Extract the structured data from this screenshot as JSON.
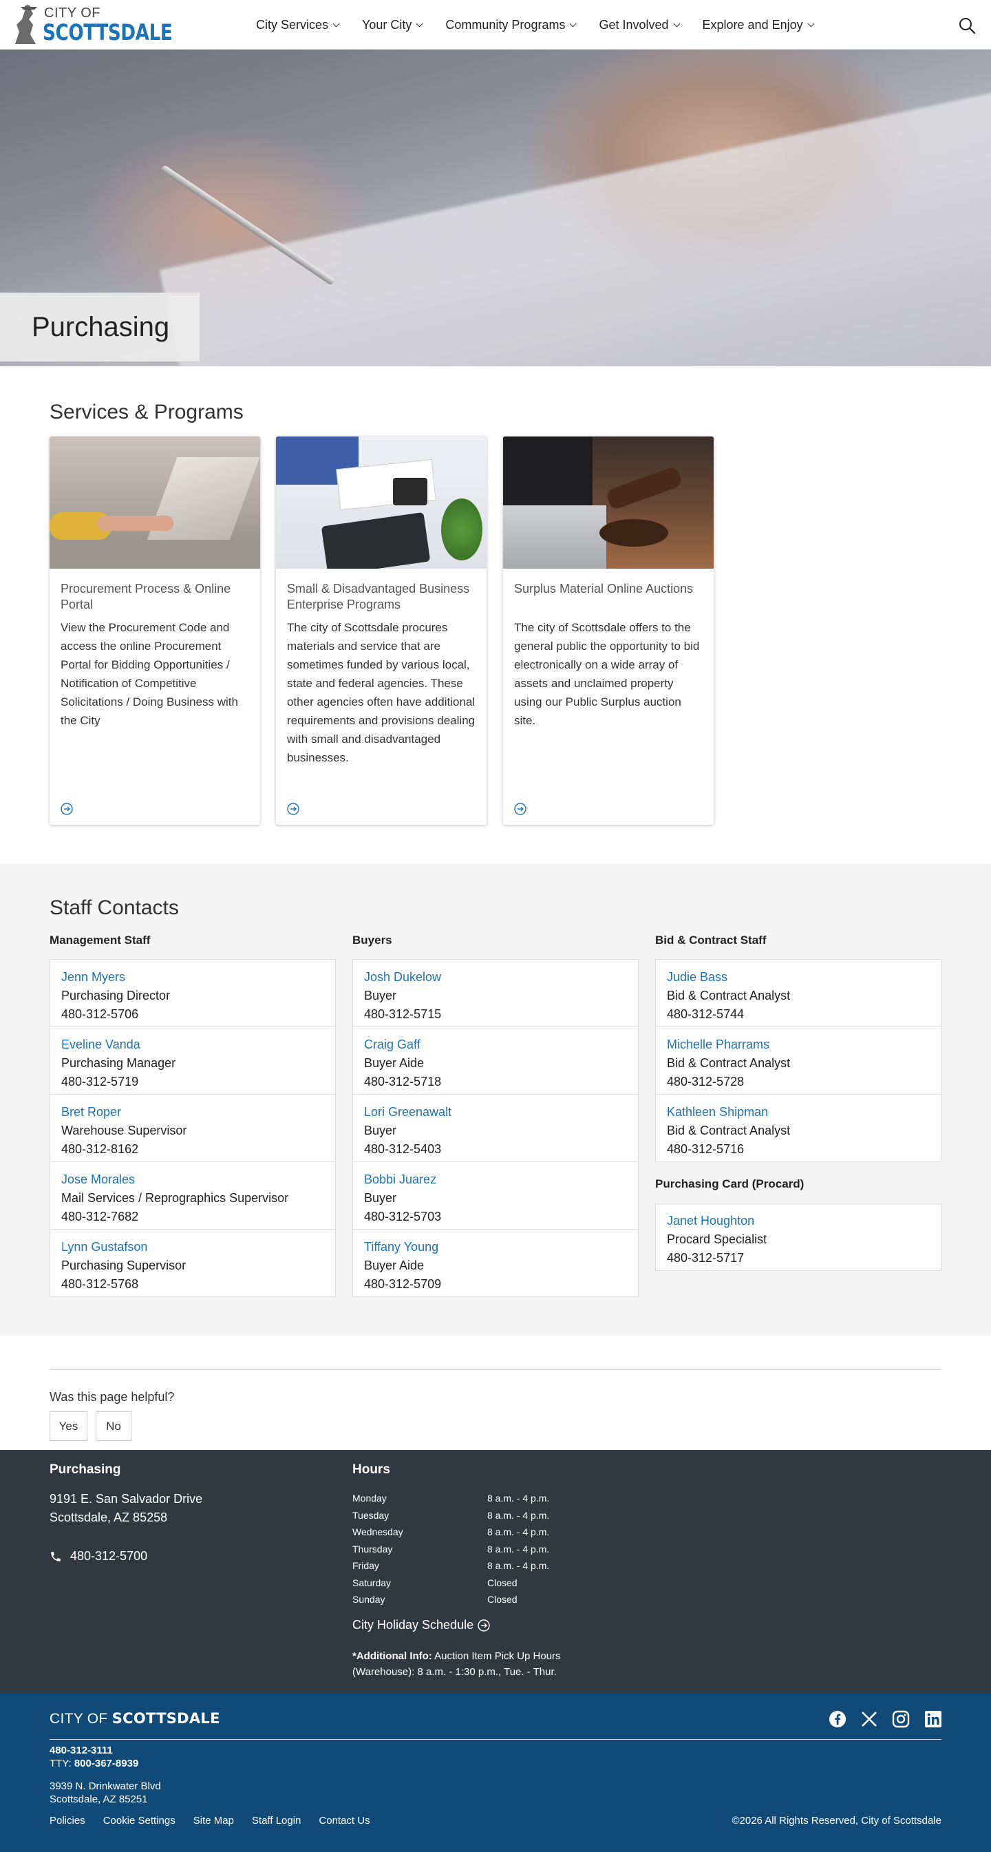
{
  "header": {
    "logo_small": "CITY OF",
    "logo_big": "SCOTTSDALE",
    "nav": [
      "City Services",
      "Your City",
      "Community Programs",
      "Get Involved",
      "Explore and Enjoy"
    ],
    "search_icon": "search-icon"
  },
  "hero": {
    "title": "Purchasing"
  },
  "services": {
    "title": "Services & Programs",
    "cards": [
      {
        "title": "Procurement Process & Online Portal",
        "desc": "View the Procurement Code and access the online Procurement Portal for Bidding Opportunities / Notification of Competitive Solicitations / Doing Business with the City",
        "icon": "arrow-circle-right-icon"
      },
      {
        "title": "Small & Disadvantaged Business Enterprise Programs",
        "desc": "The city of Scottsdale procures materials and service that are sometimes funded by various local, state and federal agencies. These other agencies often have additional requirements and provisions dealing with small and disadvantaged businesses.",
        "icon": "arrow-circle-right-icon"
      },
      {
        "title": "Surplus Material Online Auctions",
        "desc": "The city of Scottsdale offers to the general public the opportunity to bid electronically on a wide array of assets and unclaimed property using our Public Surplus auction site.",
        "icon": "arrow-circle-right-icon"
      }
    ]
  },
  "staff": {
    "title": "Staff Contacts",
    "management": {
      "heading": "Management Staff",
      "people": [
        {
          "name": "Jenn Myers",
          "title": "Purchasing Director",
          "phone": "480-312-5706"
        },
        {
          "name": "Eveline Vanda",
          "title": "Purchasing Manager",
          "phone": "480-312-5719"
        },
        {
          "name": "Bret Roper",
          "title": "Warehouse Supervisor",
          "phone": "480-312-8162"
        },
        {
          "name": "Jose Morales",
          "title": "Mail Services / Reprographics Supervisor",
          "phone": "480-312-7682"
        },
        {
          "name": "Lynn Gustafson",
          "title": "Purchasing Supervisor",
          "phone": "480-312-5768"
        }
      ]
    },
    "buyers": {
      "heading": "Buyers",
      "people": [
        {
          "name": "Josh Dukelow",
          "title": "Buyer",
          "phone": "480-312-5715"
        },
        {
          "name": "Craig Gaff",
          "title": "Buyer Aide",
          "phone": "480-312-5718"
        },
        {
          "name": "Lori Greenawalt",
          "title": "Buyer",
          "phone": "480-312-5403"
        },
        {
          "name": "Bobbi Juarez",
          "title": "Buyer",
          "phone": "480-312-5703"
        },
        {
          "name": "Tiffany Young",
          "title": "Buyer Aide",
          "phone": "480-312-5709"
        }
      ]
    },
    "bid": {
      "heading": "Bid & Contract Staff",
      "people": [
        {
          "name": "Judie Bass",
          "title": "Bid & Contract Analyst",
          "phone": "480-312-5744"
        },
        {
          "name": "Michelle Pharrams",
          "title": "Bid & Contract Analyst",
          "phone": "480-312-5728"
        },
        {
          "name": "Kathleen Shipman",
          "title": "Bid & Contract Analyst",
          "phone": "480-312-5716"
        }
      ]
    },
    "procard": {
      "heading": "Purchasing Card (Procard)",
      "people": [
        {
          "name": "Janet Houghton",
          "title": "Procard Specialist",
          "phone": "480-312-5717"
        }
      ]
    }
  },
  "feedback": {
    "question": "Was this page helpful?",
    "yes": "Yes",
    "no": "No"
  },
  "info": {
    "heading": "Purchasing",
    "address_line1": "9191 E. San Salvador Drive",
    "address_line2": "Scottsdale, AZ 85258",
    "phone": "480-312-5700",
    "hours_heading": "Hours",
    "hours": [
      {
        "day": "Monday",
        "time": "8 a.m. - 4 p.m."
      },
      {
        "day": "Tuesday",
        "time": "8 a.m. - 4 p.m."
      },
      {
        "day": "Wednesday",
        "time": "8 a.m. - 4 p.m."
      },
      {
        "day": "Thursday",
        "time": "8 a.m. - 4 p.m."
      },
      {
        "day": "Friday",
        "time": "8 a.m. - 4 p.m."
      },
      {
        "day": "Saturday",
        "time": "Closed"
      },
      {
        "day": "Sunday",
        "time": "Closed"
      }
    ],
    "holiday_link": "City Holiday Schedule",
    "additional_label": "*Additional Info:",
    "additional_text": " Auction Item Pick Up Hours (Warehouse): 8 a.m. - 1:30 p.m., Tue. - Thur."
  },
  "footer": {
    "logo_city": "CITY OF ",
    "logo_name": "SCOTTSDALE",
    "phone": "480-312-3111",
    "tty_label": "TTY: ",
    "tty": "800-367-8939",
    "address_line1": "3939 N. Drinkwater Blvd",
    "address_line2": "Scottsdale, AZ 85251",
    "links": [
      "Policies",
      "Cookie Settings",
      "Site Map",
      "Staff Login",
      "Contact Us"
    ],
    "copyright": "©2026 All Rights Reserved, City of Scottsdale",
    "social_icons": [
      "facebook-icon",
      "x-icon",
      "instagram-icon",
      "linkedin-icon"
    ]
  },
  "colors": {
    "link": "#1b74b8",
    "info_bg": "#2f393f",
    "footer_bg": "#0f4a78",
    "staff_bg": "#f5f5f5"
  }
}
